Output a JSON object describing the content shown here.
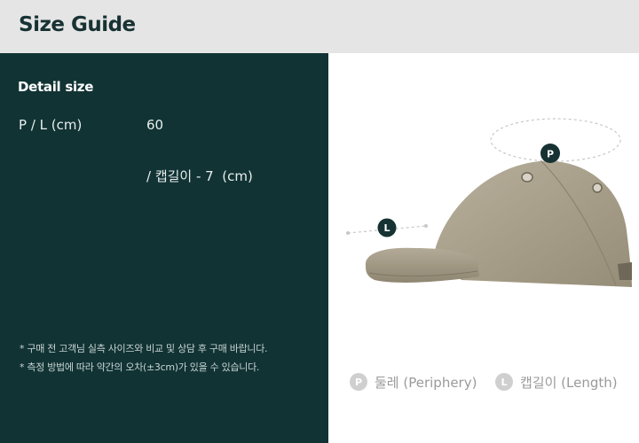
{
  "header": {
    "title": "Size Guide"
  },
  "detail": {
    "title": "Detail size",
    "spec_label": "P / L (cm)",
    "spec_value": "60",
    "spec_extra": "/ 캡길이 - 7  (cm)"
  },
  "notes": [
    "* 구매 전 고객님 실측 사이즈와 비교 및 상담 후 구매 바랍니다.",
    "* 측정 방법에 따라 약간의 오차(±3cm)가 있을 수 있습니다."
  ],
  "figure": {
    "marker_p": "P",
    "marker_l": "L",
    "cap_color": "#aaa28e",
    "marker_color": "#173233",
    "guide_color": "#c8c8c8"
  },
  "legend": [
    {
      "badge": "P",
      "label": "둘레 (Periphery)"
    },
    {
      "badge": "L",
      "label": "캡길이 (Length)"
    }
  ],
  "colors": {
    "header_bg": "#e5e5e5",
    "panel_bg": "#113334",
    "title": "#173233"
  }
}
